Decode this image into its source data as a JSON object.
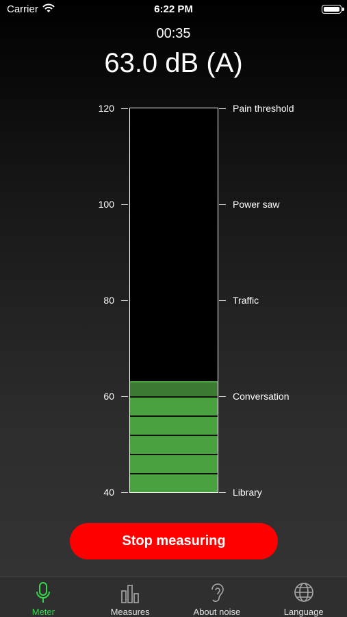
{
  "status_bar": {
    "carrier": "Carrier",
    "time": "6:22 PM"
  },
  "timer": "00:35",
  "reading": "63.0 dB (A)",
  "meter": {
    "level_db": 63.0,
    "range_db": [
      40,
      120
    ],
    "ticks": [
      {
        "value": "120",
        "label": "Pain threshold"
      },
      {
        "value": "100",
        "label": "Power saw"
      },
      {
        "value": "80",
        "label": "Traffic"
      },
      {
        "value": "60",
        "label": "Conversation"
      },
      {
        "value": "40",
        "label": "Library"
      }
    ],
    "fill_color": "#4aa140",
    "peak_color": "#3b7a31"
  },
  "stop_button": {
    "label": "Stop measuring",
    "color": "#ff0000"
  },
  "tabs": [
    {
      "label": "Meter",
      "icon": "microphone-icon",
      "active": true
    },
    {
      "label": "Measures",
      "icon": "bar-chart-icon",
      "active": false
    },
    {
      "label": "About noise",
      "icon": "ear-icon",
      "active": false
    },
    {
      "label": "Language",
      "icon": "globe-icon",
      "active": false
    }
  ],
  "accent_color": "#32d74b"
}
